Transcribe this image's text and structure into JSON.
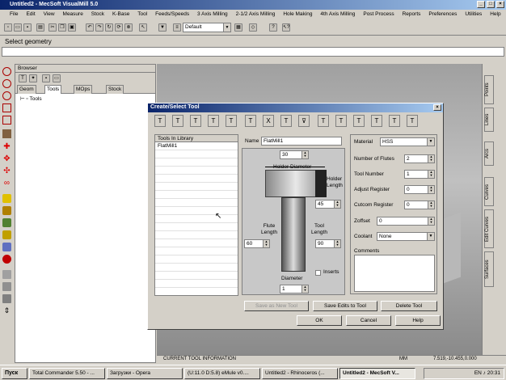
{
  "window": {
    "title": "Untitled2 - MecSoft VisualMill 5.0"
  },
  "menu": [
    "File",
    "Edit",
    "View",
    "Measure",
    "Stock",
    "K-Base",
    "Tool",
    "Feeds/Speeds",
    "3 Axis Milling",
    "2-1/2 Axis Milling",
    "Hole Making",
    "4th Axis Milling",
    "Post Process",
    "Reports",
    "Preferences",
    "Utilities",
    "Help"
  ],
  "toolbar": {
    "layer_combo": "Default"
  },
  "prompt": {
    "text": "Select geometry"
  },
  "browser": {
    "title": "Browser",
    "tabs": [
      "Geom",
      "Tools",
      "MOps",
      "Stock"
    ],
    "tree_item": "Tools"
  },
  "right_tabs": [
    "Points",
    "Lines",
    "Arcs",
    "Curves",
    "Edit Curves",
    "Surfaces"
  ],
  "status": {
    "current_tool": "CURRENT TOOL INFORMATION",
    "mm": "MM",
    "coords": "7.519,-10.455,0.000"
  },
  "dialog": {
    "title": "Create/Select Tool",
    "library_header": "Tools In Library",
    "library_items": [
      "FlatMill1"
    ],
    "name_label": "Name",
    "name_value": "FlatMill1",
    "holder_diameter_label": "Holder Diameter",
    "holder_diameter_value": "30",
    "holder_length_label": "Holder Length",
    "holder_length_value": "45",
    "flute_length_label": "Flute Length",
    "flute_length_value": "60",
    "tool_length_label": "Tool Length",
    "tool_length_value": "90",
    "inserts_label": "Inserts",
    "diameter_label": "Diameter",
    "diameter_value": "1",
    "material_label": "Material",
    "material_value": "HSS",
    "flutes_label": "Number of Flutes",
    "flutes_value": "2",
    "tool_number_label": "Tool Number",
    "tool_number_value": "1",
    "adjust_label": "Adjust Register",
    "adjust_value": "0",
    "cutcom_label": "Cutcom Register",
    "cutcom_value": "0",
    "zoffset_label": "Zoffset",
    "zoffset_value": "0",
    "coolant_label": "Coolant",
    "coolant_value": "None",
    "comments_label": "Comments",
    "btn_save_new": "Save as New Tool",
    "btn_save_edits": "Save Edits to Tool",
    "btn_delete": "Delete Tool",
    "btn_ok": "OK",
    "btn_cancel": "Cancel",
    "btn_help": "Help"
  },
  "taskbar": {
    "start": "Пуск",
    "tasks": [
      "Total Commander 5.50 - ...",
      "Загрузки - Opera",
      "(U:11.0 D:5.8) eMule v0....",
      "Untitled2 - Rhinoceros (...",
      "Untitled2 - MecSoft V..."
    ],
    "lang": "EN",
    "clock": "20:31"
  }
}
